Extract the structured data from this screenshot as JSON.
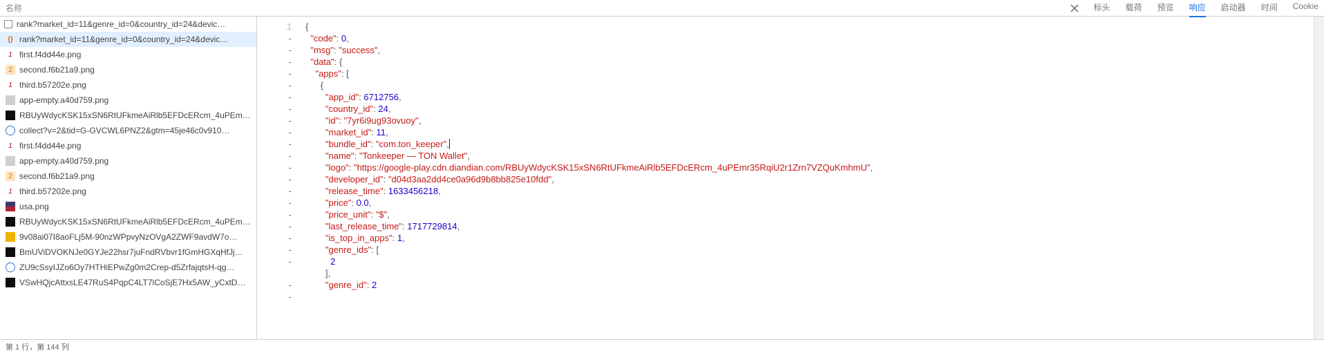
{
  "toolbar": {
    "side_label": "名称",
    "close_icon": "close-icon",
    "tabs": [
      "标头",
      "载荷",
      "预览",
      "响应",
      "启动器",
      "时间",
      "Cookie"
    ],
    "active_tab_index": 3
  },
  "network_rows": [
    {
      "icon": "checkbox",
      "name": "rank?market_id=11&genre_id=0&country_id=24&devic…",
      "selected": false
    },
    {
      "icon": "braces",
      "name": "rank?market_id=11&genre_id=0&country_id=24&devic…",
      "selected": true
    },
    {
      "icon": "png-strike",
      "name": "first.f4dd44e.png",
      "selected": false
    },
    {
      "icon": "png2",
      "name": "second.f6b21a9.png",
      "selected": false
    },
    {
      "icon": "png-strike",
      "name": "third.b57202e.png",
      "selected": false
    },
    {
      "icon": "img-pale",
      "name": "app-empty.a40d759.png",
      "selected": false
    },
    {
      "icon": "img-dark",
      "name": "RBUyWdycKSK15xSN6RtUFkmeAiRlb5EFDcERcm_4uPEm…",
      "selected": false
    },
    {
      "icon": "circ-o",
      "name": "collect?v=2&tid=G-GVCWL6PNZ2&gtm=45je46c0v910…",
      "selected": false
    },
    {
      "icon": "png-strike",
      "name": "first.f4dd44e.png",
      "selected": false
    },
    {
      "icon": "img-pale",
      "name": "app-empty.a40d759.png",
      "selected": false
    },
    {
      "icon": "png2",
      "name": "second.f6b21a9.png",
      "selected": false
    },
    {
      "icon": "png-strike",
      "name": "third.b57202e.png",
      "selected": false
    },
    {
      "icon": "flag",
      "name": "usa.png",
      "selected": false
    },
    {
      "icon": "img-dark",
      "name": "RBUyWdycKSK15xSN6RtUFkmeAiRlb5EFDcERcm_4uPEm…",
      "selected": false
    },
    {
      "icon": "img-gold",
      "name": "9v08ai07I8aoFLj5M-90nzWPpvyNzOVgA2ZWF9avdW7o…",
      "selected": false
    },
    {
      "icon": "img-dark",
      "name": "BmUViDVOKNJe0GYJe22hsr7juFndRVbvr1fGmHGXqHfJj…",
      "selected": false
    },
    {
      "icon": "circ-o",
      "name": "ZU9cSsyIJZo6Oy7HTHiEPwZg0m2Crep-d5ZrfajqtsH-qg…",
      "selected": false
    },
    {
      "icon": "img-dark",
      "name": "VSwHQjcAttxsLE47RuS4PqpC4LT7lCoSjE7Hx5AW_yCxtD…",
      "selected": false
    }
  ],
  "code": {
    "glyphs": [
      "1",
      "-",
      "-",
      "-",
      "-",
      "-",
      "-",
      "-",
      "-",
      "-",
      "-",
      "-",
      "-",
      "-",
      "-",
      "-",
      "-",
      "-",
      "-",
      "-",
      "-",
      "",
      "-",
      "-"
    ],
    "lines": [
      {
        "indent": 0,
        "tokens": [
          {
            "t": "pn",
            "v": "{"
          }
        ]
      },
      {
        "indent": 2,
        "tokens": [
          {
            "t": "k",
            "v": "\"code\""
          },
          {
            "t": "pn",
            "v": ": "
          },
          {
            "t": "n",
            "v": "0"
          },
          {
            "t": "pn",
            "v": ","
          }
        ]
      },
      {
        "indent": 2,
        "tokens": [
          {
            "t": "k",
            "v": "\"msg\""
          },
          {
            "t": "pn",
            "v": ": "
          },
          {
            "t": "s",
            "v": "\"success\""
          },
          {
            "t": "pn",
            "v": ","
          }
        ]
      },
      {
        "indent": 2,
        "tokens": [
          {
            "t": "k",
            "v": "\"data\""
          },
          {
            "t": "pn",
            "v": ": {"
          }
        ]
      },
      {
        "indent": 4,
        "tokens": [
          {
            "t": "k",
            "v": "\"apps\""
          },
          {
            "t": "pn",
            "v": ": ["
          }
        ]
      },
      {
        "indent": 6,
        "tokens": [
          {
            "t": "pn",
            "v": "{"
          }
        ]
      },
      {
        "indent": 8,
        "tokens": [
          {
            "t": "k",
            "v": "\"app_id\""
          },
          {
            "t": "pn",
            "v": ": "
          },
          {
            "t": "n",
            "v": "6712756"
          },
          {
            "t": "pn",
            "v": ","
          }
        ]
      },
      {
        "indent": 8,
        "tokens": [
          {
            "t": "k",
            "v": "\"country_id\""
          },
          {
            "t": "pn",
            "v": ": "
          },
          {
            "t": "n",
            "v": "24"
          },
          {
            "t": "pn",
            "v": ","
          }
        ]
      },
      {
        "indent": 8,
        "tokens": [
          {
            "t": "k",
            "v": "\"id\""
          },
          {
            "t": "pn",
            "v": ": "
          },
          {
            "t": "s",
            "v": "\"7yr6i9ug93ovuoy\""
          },
          {
            "t": "pn",
            "v": ","
          }
        ]
      },
      {
        "indent": 8,
        "tokens": [
          {
            "t": "k",
            "v": "\"market_id\""
          },
          {
            "t": "pn",
            "v": ": "
          },
          {
            "t": "n",
            "v": "11"
          },
          {
            "t": "pn",
            "v": ","
          }
        ]
      },
      {
        "indent": 8,
        "tokens": [
          {
            "t": "k",
            "v": "\"bundle_id\""
          },
          {
            "t": "pn",
            "v": ": "
          },
          {
            "t": "s",
            "v": "\"com.ton_keeper\""
          },
          {
            "t": "pn",
            "v": ","
          },
          {
            "t": "caret",
            "v": ""
          }
        ]
      },
      {
        "indent": 8,
        "tokens": [
          {
            "t": "k",
            "v": "\"name\""
          },
          {
            "t": "pn",
            "v": ": "
          },
          {
            "t": "s",
            "v": "\"Tonkeeper — TON Wallet\""
          },
          {
            "t": "pn",
            "v": ","
          }
        ]
      },
      {
        "indent": 8,
        "tokens": [
          {
            "t": "k",
            "v": "\"logo\""
          },
          {
            "t": "pn",
            "v": ": "
          },
          {
            "t": "s",
            "v": "\"https://google-play.cdn.diandian.com/RBUyWdycKSK15xSN6RtUFkmeAiRlb5EFDcERcm_4uPEmr35RqiU2r1Zrn7VZQuKmhmU\""
          },
          {
            "t": "pn",
            "v": ","
          }
        ]
      },
      {
        "indent": 8,
        "tokens": [
          {
            "t": "k",
            "v": "\"developer_id\""
          },
          {
            "t": "pn",
            "v": ": "
          },
          {
            "t": "s",
            "v": "\"d04d3aa2dd4ce0a96d9b8bb825e10fdd\""
          },
          {
            "t": "pn",
            "v": ","
          }
        ]
      },
      {
        "indent": 8,
        "tokens": [
          {
            "t": "k",
            "v": "\"release_time\""
          },
          {
            "t": "pn",
            "v": ": "
          },
          {
            "t": "n",
            "v": "1633456218"
          },
          {
            "t": "pn",
            "v": ","
          }
        ]
      },
      {
        "indent": 8,
        "tokens": [
          {
            "t": "k",
            "v": "\"price\""
          },
          {
            "t": "pn",
            "v": ": "
          },
          {
            "t": "n",
            "v": "0.0"
          },
          {
            "t": "pn",
            "v": ","
          }
        ]
      },
      {
        "indent": 8,
        "tokens": [
          {
            "t": "k",
            "v": "\"price_unit\""
          },
          {
            "t": "pn",
            "v": ": "
          },
          {
            "t": "s",
            "v": "\"$\""
          },
          {
            "t": "pn",
            "v": ","
          }
        ]
      },
      {
        "indent": 8,
        "tokens": [
          {
            "t": "k",
            "v": "\"last_release_time\""
          },
          {
            "t": "pn",
            "v": ": "
          },
          {
            "t": "n",
            "v": "1717729814"
          },
          {
            "t": "pn",
            "v": ","
          }
        ]
      },
      {
        "indent": 8,
        "tokens": [
          {
            "t": "k",
            "v": "\"is_top_in_apps\""
          },
          {
            "t": "pn",
            "v": ": "
          },
          {
            "t": "n",
            "v": "1"
          },
          {
            "t": "pn",
            "v": ","
          }
        ]
      },
      {
        "indent": 8,
        "tokens": [
          {
            "t": "k",
            "v": "\"genre_ids\""
          },
          {
            "t": "pn",
            "v": ": ["
          }
        ]
      },
      {
        "indent": 10,
        "tokens": [
          {
            "t": "n",
            "v": "2"
          }
        ]
      },
      {
        "indent": 8,
        "tokens": [
          {
            "t": "pn",
            "v": "],"
          }
        ]
      },
      {
        "indent": 8,
        "tokens": [
          {
            "t": "k",
            "v": "\"genre_id\""
          },
          {
            "t": "pn",
            "v": ": "
          },
          {
            "t": "n",
            "v": "2"
          }
        ]
      }
    ]
  },
  "status": {
    "cursor": "第 1 行，第 144 列"
  },
  "icon_classes": {
    "checkbox": "chk",
    "braces": "fico ic-braces",
    "png-strike": "fico ic-png-strike",
    "png2": "fico ic-png2",
    "img-pale": "fico ic-img-pale",
    "img-dark": "fico ic-img-dark",
    "circ-o": "fico ic-circ-o",
    "flag": "fico ic-flag",
    "img-gold": "fico ic-img-gold"
  },
  "icon_glyphs": {
    "braces": "{}",
    "png-strike": "1",
    "png2": "2"
  }
}
